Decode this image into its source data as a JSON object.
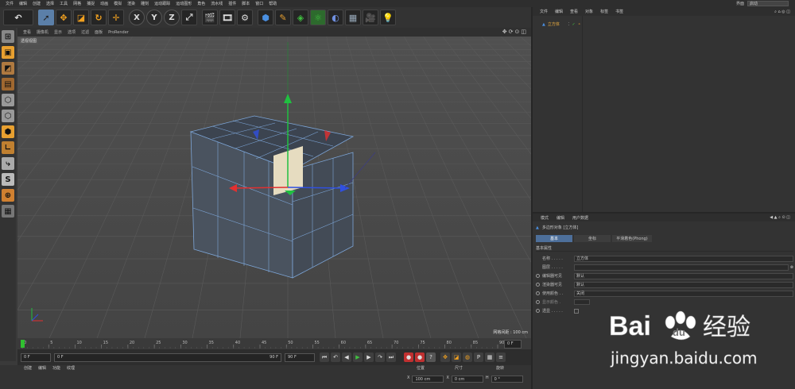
{
  "menubar": {
    "items": [
      "文件",
      "编辑",
      "创建",
      "选择",
      "工具",
      "网格",
      "捕捉",
      "动画",
      "模拟",
      "渲染",
      "雕刻",
      "运动跟踪",
      "运动图形",
      "角色",
      "流水线",
      "插件",
      "脚本",
      "窗口",
      "帮助"
    ],
    "layout_label": "界面",
    "layout_value": "启动"
  },
  "viewport": {
    "menu": [
      "查看",
      "摄像机",
      "显示",
      "选项",
      "过滤",
      "面板",
      "ProRender"
    ],
    "name": "透视视图",
    "grid_info": "网格间距 : 100 cm"
  },
  "timeline": {
    "ticks": [
      "0",
      "5",
      "10",
      "15",
      "20",
      "25",
      "30",
      "35",
      "40",
      "45",
      "50",
      "55",
      "60",
      "65",
      "70",
      "75",
      "80",
      "85",
      "90"
    ],
    "current_frame": "0 F",
    "start_field": "0 F",
    "range_start": "0 F",
    "range_end": "90 F",
    "end_field": "90 F"
  },
  "bottom": {
    "tabs": [
      "创建",
      "编辑",
      "功能",
      "纹理"
    ],
    "coord_headers": [
      "位置",
      "尺寸",
      "旋转"
    ],
    "coord_row": {
      "axis": "X",
      "pos": "100 cm",
      "size_axis": "X",
      "size": "0 cm",
      "rot_axis": "H",
      "rot": "0 °"
    }
  },
  "object_manager": {
    "menu": [
      "文件",
      "编辑",
      "查看",
      "对象",
      "标签",
      "书签"
    ],
    "object_name": "立方体"
  },
  "attributes": {
    "menu": [
      "模式",
      "编辑",
      "用户数据"
    ],
    "title": "多边形对象 [立方体]",
    "tabs": [
      "基本",
      "坐标",
      "平滑着色(Phong)"
    ],
    "section": "基本属性",
    "rows": [
      {
        "label": "名称 . . . . .",
        "value": "立方体"
      },
      {
        "label": "图层 . . . . .",
        "value": ""
      },
      {
        "label": "编辑器可见",
        "value": "默认"
      },
      {
        "label": "渲染器可见",
        "value": "默认"
      },
      {
        "label": "使用颜色 . .",
        "value": "关闭"
      },
      {
        "label": "显示颜色 .",
        "value": ""
      },
      {
        "label": "透显 . . . . .",
        "value": ""
      }
    ]
  },
  "watermark": {
    "brand": "Bai",
    "brand2": "du",
    "jingyan": "经验",
    "url": "jingyan.baidu.com"
  },
  "colors": {
    "accent": "#5b7fa8",
    "axis_x": "#e23030",
    "axis_y": "#20c040",
    "axis_z": "#3050e0",
    "selected_face": "#e6dcc0",
    "cube_face": "#48505c"
  }
}
